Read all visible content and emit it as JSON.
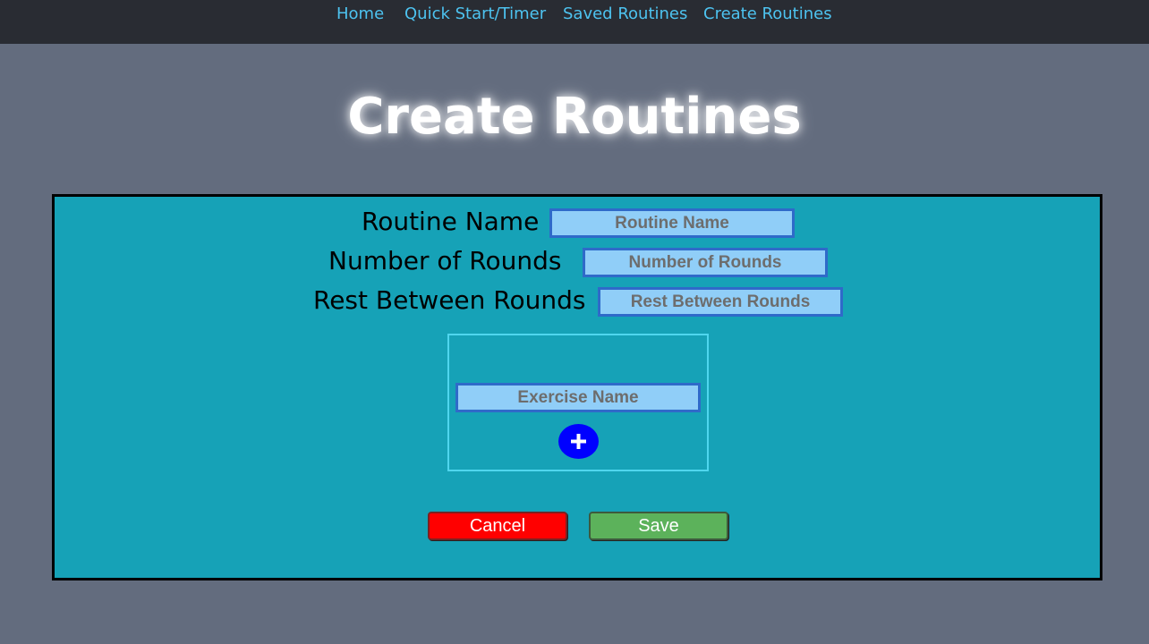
{
  "nav": {
    "items": [
      {
        "label": "Home"
      },
      {
        "label": "Quick Start/Timer"
      },
      {
        "label": "Saved Routines"
      },
      {
        "label": "Create Routines"
      }
    ]
  },
  "page": {
    "title": "Create Routines"
  },
  "form": {
    "routine_name": {
      "label": "Routine Name",
      "placeholder": "Routine Name",
      "value": ""
    },
    "rounds": {
      "label": "Number of Rounds",
      "placeholder": "Number of Rounds",
      "value": ""
    },
    "rest": {
      "label": "Rest Between Rounds",
      "placeholder": "Rest Between Rounds",
      "value": ""
    },
    "exercise": {
      "placeholder": "Exercise Name",
      "value": "",
      "add_icon": "plus-icon"
    },
    "buttons": {
      "cancel": "Cancel",
      "save": "Save"
    }
  },
  "colors": {
    "background": "#636c7e",
    "navbar": "#292c33",
    "nav_link": "#4dc3f0",
    "panel": "#16a2b7",
    "input_bg": "#90cef8",
    "input_border": "#2f6ac9",
    "add_button": "#0000ff",
    "cancel": "#ff0000",
    "save": "#5cb25b"
  }
}
